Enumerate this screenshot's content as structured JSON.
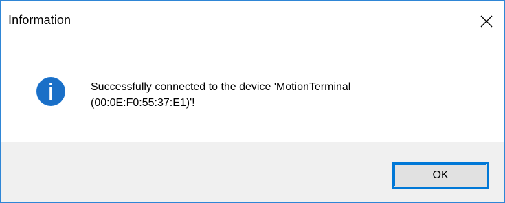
{
  "window": {
    "title": "Information",
    "close_icon": "close-icon"
  },
  "content": {
    "icon": "info-icon",
    "message_line1": "Successfully connected to the device 'MotionTerminal",
    "message_line2": "(00:0E:F0:55:37:E1)'!"
  },
  "footer": {
    "ok_label": "OK"
  },
  "colors": {
    "border": "#2f86d6",
    "icon_blue": "#1f77d0",
    "footer_bg": "#f0f0f0",
    "button_bg": "#e1e1e1",
    "button_border": "#0078d7"
  }
}
